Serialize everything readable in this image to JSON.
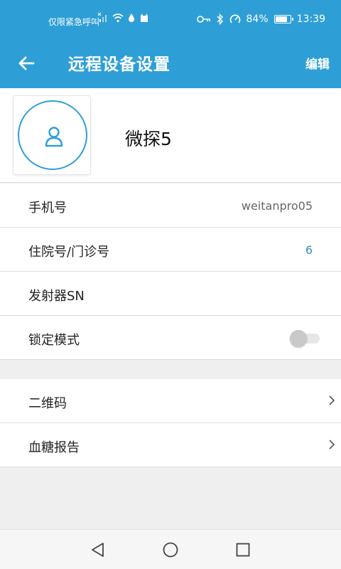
{
  "status_bar": {
    "carrier_text": "仅限紧急呼叫",
    "battery_text": "84%",
    "battery_level": 0.84,
    "time": "13:39",
    "icons": [
      "no-sim-icon",
      "wifi-icon",
      "drop-icon",
      "cat-icon",
      "key-icon",
      "bluetooth-icon",
      "speedometer-icon",
      "battery-icon"
    ]
  },
  "header": {
    "title": "远程设备设置",
    "edit_label": "编辑",
    "back_icon": "arrow-left-icon"
  },
  "profile": {
    "name": "微探5",
    "avatar_icon": "user-icon"
  },
  "rows": {
    "phone": {
      "label": "手机号",
      "value": "weitanpro05"
    },
    "hospital_id": {
      "label": "住院号/门诊号",
      "value": "6"
    },
    "transmitter_sn": {
      "label": "发射器SN",
      "value": ""
    },
    "lock_mode": {
      "label": "锁定模式",
      "toggle_on": false
    }
  },
  "links": {
    "qr_code": {
      "label": "二维码"
    },
    "glucose_report": {
      "label": "血糖报告"
    }
  },
  "colors": {
    "accent": "#2e9fd6",
    "value_blue": "#2e8fc4",
    "background": "#efefef"
  },
  "nav_bar": {
    "icons": [
      "back-triangle-icon",
      "home-circle-icon",
      "recents-square-icon"
    ]
  }
}
